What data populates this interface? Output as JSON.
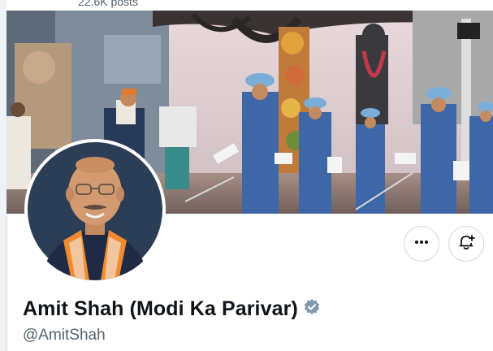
{
  "header": {
    "post_count": "22.6K posts"
  },
  "banner": {
    "description_icon": "parade-photo"
  },
  "profile": {
    "display_name": "Amit Shah (Modi Ka Parivar)",
    "handle": "@AmitShah",
    "verified_badge_color": "#829aab"
  },
  "actions": {
    "more_icon": "more-horizontal-icon",
    "notify_icon": "bell-plus-icon"
  },
  "colors": {
    "text_primary": "#0f1419",
    "text_secondary": "#536471",
    "border": "#cfd9de"
  }
}
